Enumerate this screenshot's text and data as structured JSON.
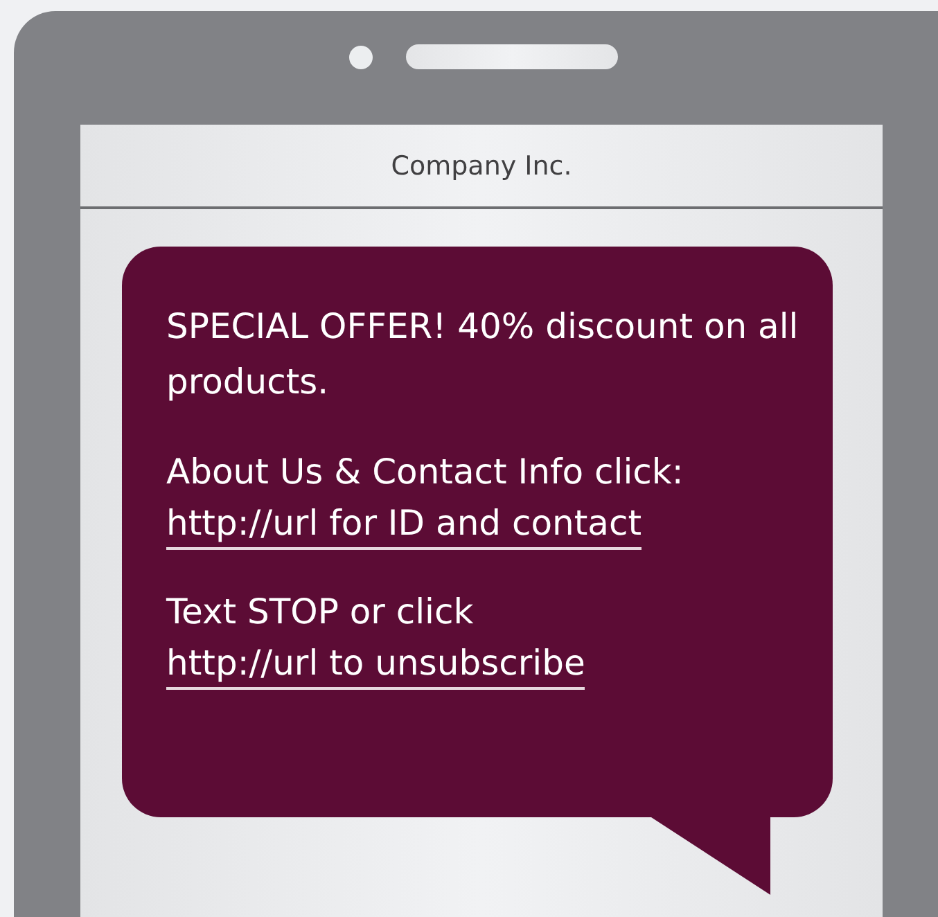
{
  "phone": {
    "header": {
      "title": "Company Inc."
    }
  },
  "message": {
    "paragraphs": [
      {
        "text": "SPECIAL OFFER! 40% discount on all products."
      },
      {
        "text": "About Us & Contact Info click:",
        "link": "http://url for ID and contact"
      },
      {
        "text": "Text STOP or click",
        "link": "http://url to unsubscribe"
      }
    ]
  }
}
